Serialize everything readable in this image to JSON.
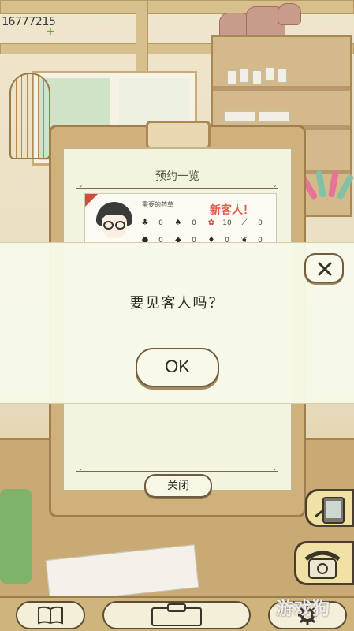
{
  "status": {
    "money": "16777215"
  },
  "panel": {
    "title": "预约一览",
    "card": {
      "label": "需要的药草",
      "new_guest": "新客人！",
      "herbs_row1": [
        {
          "icon": "leaf-herb-icon",
          "value": "0"
        },
        {
          "icon": "sprout-herb-icon",
          "value": "0"
        },
        {
          "icon": "red-flower-herb-icon",
          "value": "10"
        },
        {
          "icon": "branch-herb-icon",
          "value": "0"
        }
      ],
      "herbs_row2": [
        {
          "icon": "berry-herb-icon",
          "value": "0"
        },
        {
          "icon": "dark-berry-herb-icon",
          "value": "0"
        },
        {
          "icon": "seed-herb-icon",
          "value": "0"
        },
        {
          "icon": "feather-herb-icon",
          "value": "0"
        }
      ]
    },
    "close_label": "关闭"
  },
  "dialog": {
    "message": "要见客人吗？",
    "ok_label": "OK"
  },
  "watermark": "游戏狗",
  "colors": {
    "accent_red": "#e05a4e",
    "panel_wood": "#d1b17b",
    "paper": "#f2f4df",
    "button_fill": "#f8f9e8",
    "side_button": "#f0e2a4"
  }
}
